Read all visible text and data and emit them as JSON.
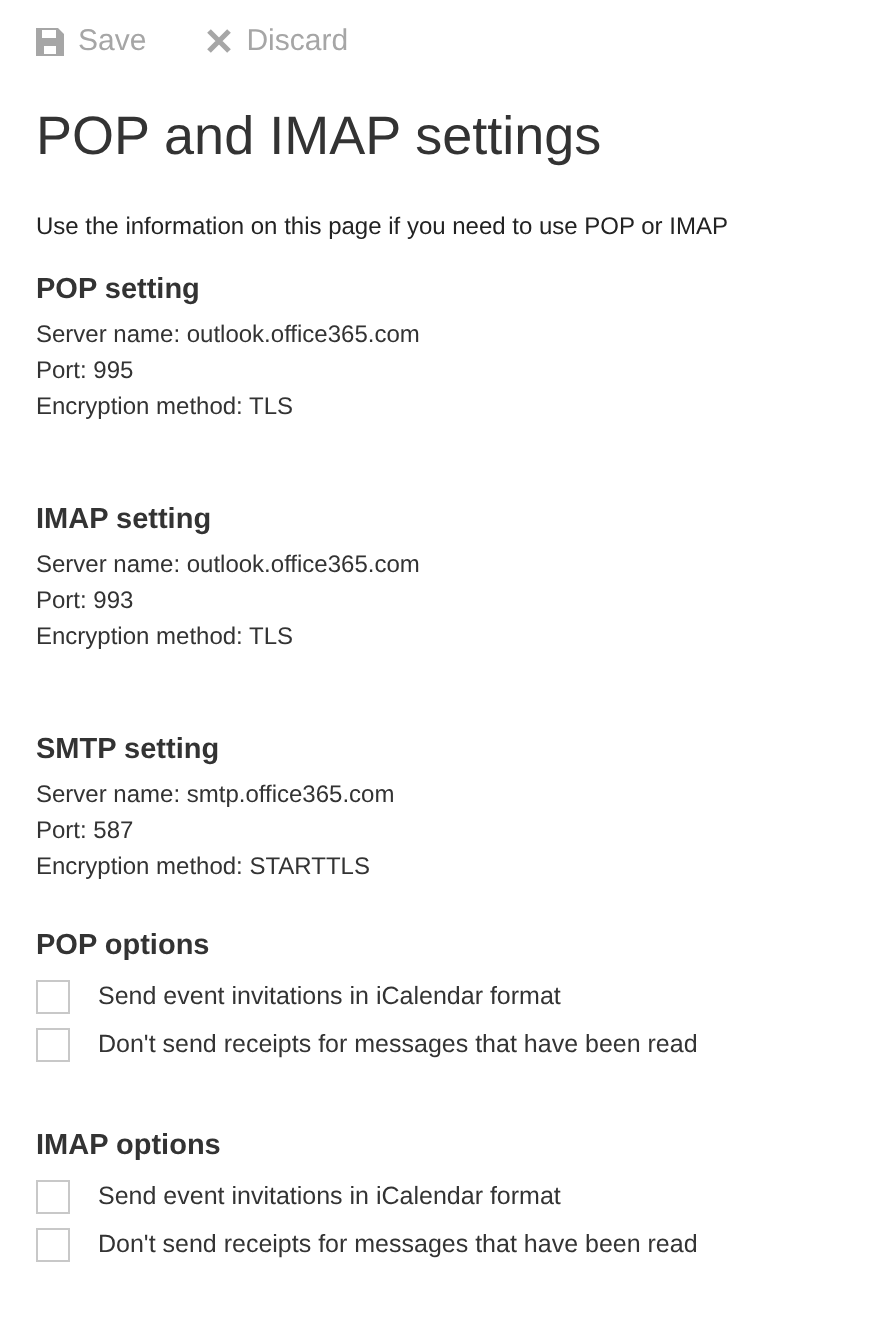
{
  "toolbar": [
    {
      "kind": "save",
      "label": "Save",
      "disabled": true
    },
    {
      "kind": "discard",
      "label": "Discard",
      "disabled": true
    }
  ],
  "title": "POP and IMAP settings",
  "intro": "Use the information on this page if you need to use POP or IMAP",
  "settings": [
    {
      "heading": "POP setting",
      "lines": [
        "Server name: outlook.office365.com",
        "Port: 995",
        "Encryption method: TLS"
      ]
    },
    {
      "heading": "IMAP setting",
      "lines": [
        "Server name: outlook.office365.com",
        "Port: 993",
        "Encryption method: TLS"
      ]
    },
    {
      "heading": "SMTP setting",
      "lines": [
        "Server name: smtp.office365.com",
        "Port: 587",
        "Encryption method: STARTTLS"
      ]
    }
  ],
  "options": [
    {
      "heading": "POP options",
      "items": [
        {
          "label": "Send event invitations in iCalendar format",
          "checked": false
        },
        {
          "label": "Don't send receipts for messages that have been read",
          "checked": false
        }
      ]
    },
    {
      "heading": "IMAP options",
      "items": [
        {
          "label": "Send event invitations in iCalendar format",
          "checked": false
        },
        {
          "label": "Don't send receipts for messages that have been read",
          "checked": false
        }
      ]
    }
  ]
}
